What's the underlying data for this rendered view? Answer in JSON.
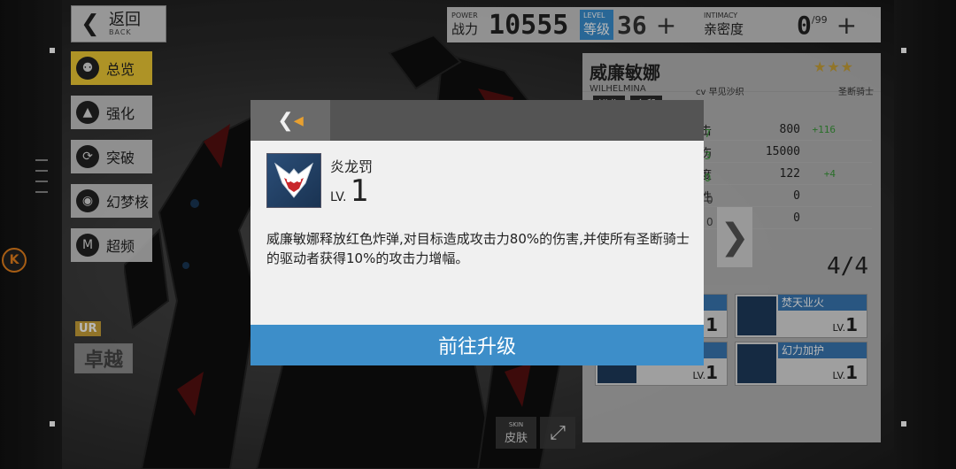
{
  "back": {
    "label": "返回",
    "sub": "BACK"
  },
  "power": {
    "en": "POWER",
    "cn": "战力",
    "value": "10555"
  },
  "level": {
    "en": "LEVEL",
    "cn": "等级",
    "value": "36",
    "plus": "+"
  },
  "intimacy": {
    "en": "INTIMACY",
    "cn": "亲密度",
    "value": "0",
    "max": "/99",
    "plus": "+"
  },
  "side_menu": [
    {
      "label": "总览",
      "icon": "overview-icon",
      "glyph": "⚉",
      "active": true
    },
    {
      "label": "强化",
      "icon": "enhance-icon",
      "glyph": "▲"
    },
    {
      "label": "突破",
      "icon": "breakthrough-icon",
      "glyph": "⟳"
    },
    {
      "label": "幻梦核",
      "icon": "dream-core-icon",
      "glyph": "◉"
    },
    {
      "label": "超频",
      "icon": "overclock-icon",
      "glyph": "M"
    }
  ],
  "rarity": "UR",
  "rank_badge": "卓越",
  "k_button": "K",
  "character": {
    "name": "威廉敏娜",
    "name_en": "WILHELMINA",
    "cv": "cv 早见沙织",
    "class": "圣断骑士",
    "stars": "★★★",
    "tags": [
      "进化",
      "多段"
    ],
    "stats": [
      {
        "name": "暴击",
        "value": "800",
        "bonus": "+116",
        "left": "57"
      },
      {
        "name": "暴伤",
        "value": "15000",
        "bonus": "",
        "left": "53"
      },
      {
        "name": "速度",
        "value": "122",
        "bonus": "+4",
        "left": "40"
      },
      {
        "name": "韧性",
        "value": "0",
        "bonus": "",
        "left": "0"
      },
      {
        "name": "伤",
        "value": "0",
        "bonus": "",
        "left": "0"
      }
    ],
    "skill_count": "4/4",
    "skills": [
      {
        "name": "焚天业火",
        "lv_label": "LV.",
        "lv": "1"
      },
      {
        "name": "幻力加护",
        "lv_label": "LV.",
        "lv": "1"
      },
      {
        "name": "",
        "lv_label": "",
        "lv": "1"
      },
      {
        "name": "",
        "lv_label": "LV.",
        "lv": "1"
      }
    ]
  },
  "skin": {
    "en": "SKIN",
    "cn": "皮肤"
  },
  "modal": {
    "skill_name": "炎龙罚",
    "lv_label": "LV.",
    "lv_value": "1",
    "description": "威廉敏娜释放红色炸弹,对目标造成攻击力80%的伤害,并使所有圣断骑士的驱动者获得10%的攻击力增幅。",
    "button": "前往升级"
  },
  "colors": {
    "accent_blue": "#3d8ec9",
    "menu_active": "#f2cc35",
    "k_orange": "#e8821c"
  }
}
